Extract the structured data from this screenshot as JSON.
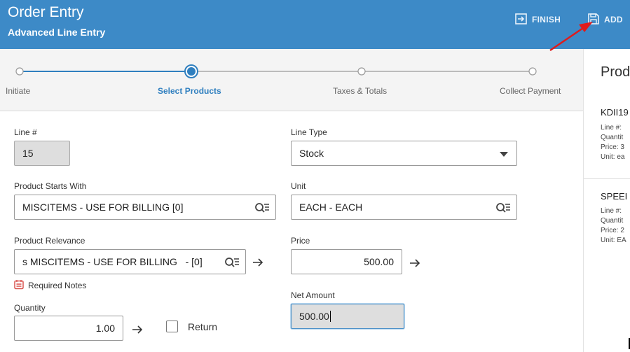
{
  "header": {
    "title": "Order Entry",
    "subtitle": "Advanced Line Entry",
    "finish_label": "FINISH",
    "add_label": "ADD"
  },
  "stepper": {
    "steps": [
      {
        "label": "Initiate",
        "state": "done"
      },
      {
        "label": "Select Products",
        "state": "active"
      },
      {
        "label": "Taxes & Totals",
        "state": "pending"
      },
      {
        "label": "Collect Payment",
        "state": "pending"
      }
    ]
  },
  "form": {
    "line_num": {
      "label": "Line #",
      "value": "15"
    },
    "line_type": {
      "label": "Line Type",
      "value": "Stock"
    },
    "product_starts": {
      "label": "Product Starts With",
      "value": "MISCITEMS - USE FOR BILLING [0]"
    },
    "unit": {
      "label": "Unit",
      "value": "EACH - EACH"
    },
    "product_relevance": {
      "label": "Product Relevance",
      "value": "s MISCITEMS - USE FOR BILLING   - [0]"
    },
    "price": {
      "label": "Price",
      "value": "500.00"
    },
    "required_notes": "Required Notes",
    "net_amount": {
      "label": "Net Amount",
      "value": "500.00"
    },
    "quantity": {
      "label": "Quantity",
      "value": "1.00"
    },
    "return_label": "Return"
  },
  "side_panel": {
    "title": "Prod",
    "items": [
      {
        "name": "KDII19",
        "line": "Line #:",
        "quantity": "Quantit",
        "price": "Price: 3",
        "unit": "Unit: ea"
      },
      {
        "name": "SPEEI",
        "line": "Line #:",
        "quantity": "Quantit",
        "price": "Price: 2",
        "unit": "Unit: EA"
      }
    ]
  },
  "colors": {
    "header_bg": "#3d8ac7",
    "accent": "#2f7fbf",
    "annotation_arrow": "#e01b1b",
    "required_icon": "#d9534f"
  }
}
